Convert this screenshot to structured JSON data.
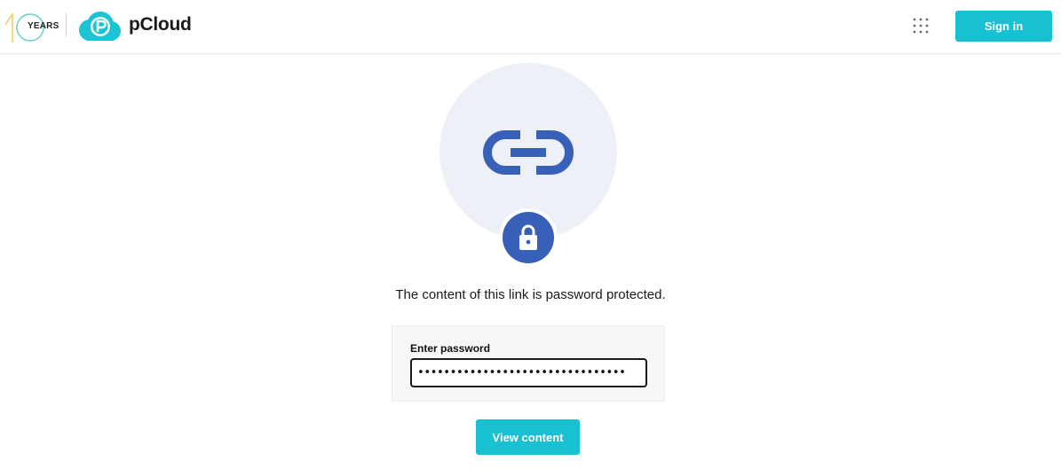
{
  "header": {
    "years_badge": "YEARS",
    "brand": "pCloud",
    "apps_icon": "grid-dots-icon",
    "signin_label": "Sign in"
  },
  "hero": {
    "main_icon": "link-icon",
    "badge_icon": "lock-icon"
  },
  "main": {
    "message": "The content of this link is password protected.",
    "password_label": "Enter password",
    "password_value": "••••••••••••••••••••••••••••••••",
    "submit_label": "View content"
  },
  "colors": {
    "accent": "#17c1d1",
    "icon_blue": "#3960b9",
    "hero_bg": "#edf1f7"
  }
}
